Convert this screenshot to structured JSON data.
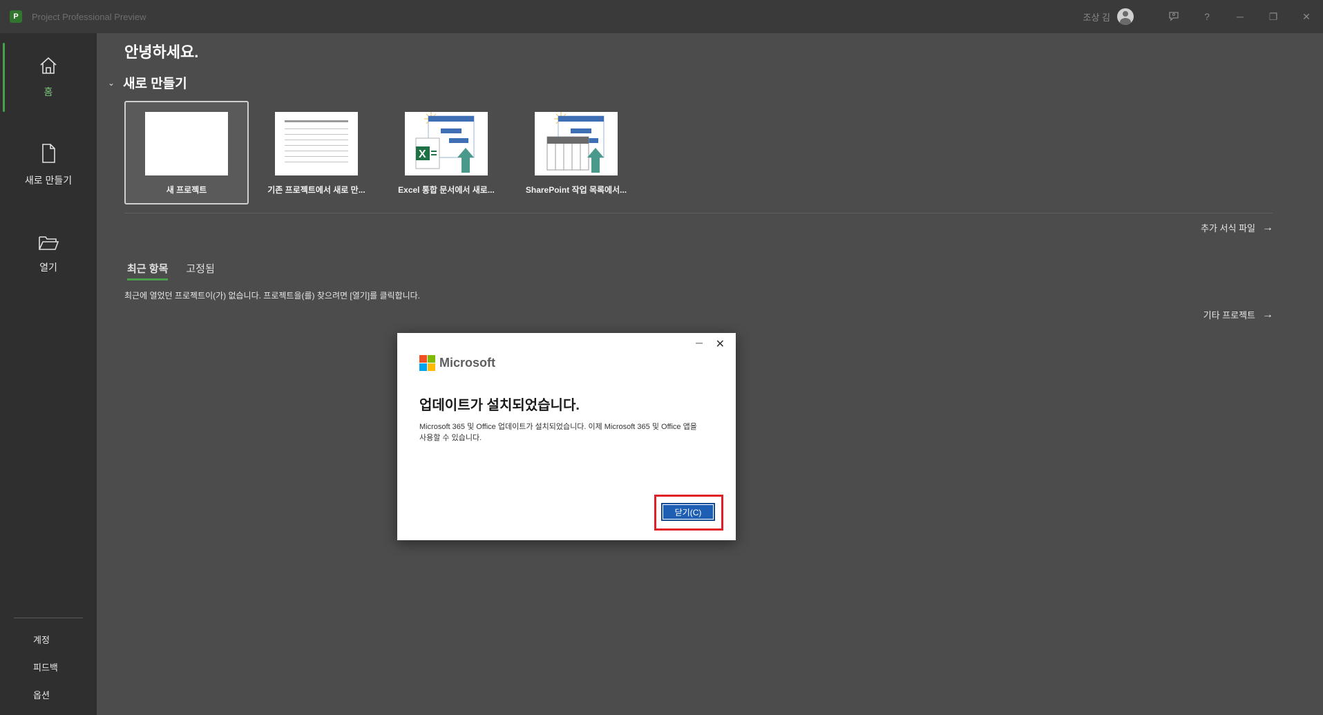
{
  "titlebar": {
    "app_title": "Project Professional Preview",
    "app_icon": "P",
    "user_name": "조상 김",
    "feedback_icon": "feedback-icon",
    "help": "?",
    "minimize": "─",
    "restore": "❐",
    "close": "✕"
  },
  "sidebar": {
    "items": [
      {
        "label": "홈",
        "icon": "home-icon"
      },
      {
        "label": "새로 만들기",
        "icon": "new-file-icon"
      },
      {
        "label": "열기",
        "icon": "open-folder-icon"
      }
    ],
    "bottom": [
      {
        "label": "계정"
      },
      {
        "label": "피드백"
      },
      {
        "label": "옵션"
      }
    ]
  },
  "main": {
    "greeting": "안녕하세요.",
    "new_section": {
      "chevron": "⌄",
      "title": "새로 만들기",
      "templates": [
        {
          "label": "새 프로젝트",
          "thumb": "blank"
        },
        {
          "label": "기존 프로젝트에서 새로 만...",
          "thumb": "lines"
        },
        {
          "label": "Excel 통합 문서에서 새로...",
          "thumb": "excel"
        },
        {
          "label": "SharePoint 작업 목록에서...",
          "thumb": "sharepoint"
        }
      ],
      "more_templates": "추가 서식 파일",
      "arrow": "→"
    },
    "tabs": [
      {
        "label": "최근 항목"
      },
      {
        "label": "고정됨"
      }
    ],
    "empty_message": "최근에 열었던 프로젝트이(가) 없습니다. 프로젝트을(를) 찾으려면 [열기]를 클릭합니다.",
    "other_projects": "기타 프로젝트"
  },
  "dialog": {
    "minimize": "─",
    "close": "✕",
    "brand": "Microsoft",
    "logo_colors": [
      "#f25022",
      "#7fba00",
      "#00a4ef",
      "#ffb900"
    ],
    "title": "업데이트가 설치되었습니다.",
    "body": "Microsoft 365 및 Office 업데이트가 설치되었습니다. 이제 Microsoft 365 및 Office 앱을 사용할 수 있습니다.",
    "close_button": "닫기(C)"
  },
  "colors": {
    "accent_green": "#4aa04a",
    "highlight_red": "#e01f26",
    "button_blue": "#1f5fb3"
  }
}
